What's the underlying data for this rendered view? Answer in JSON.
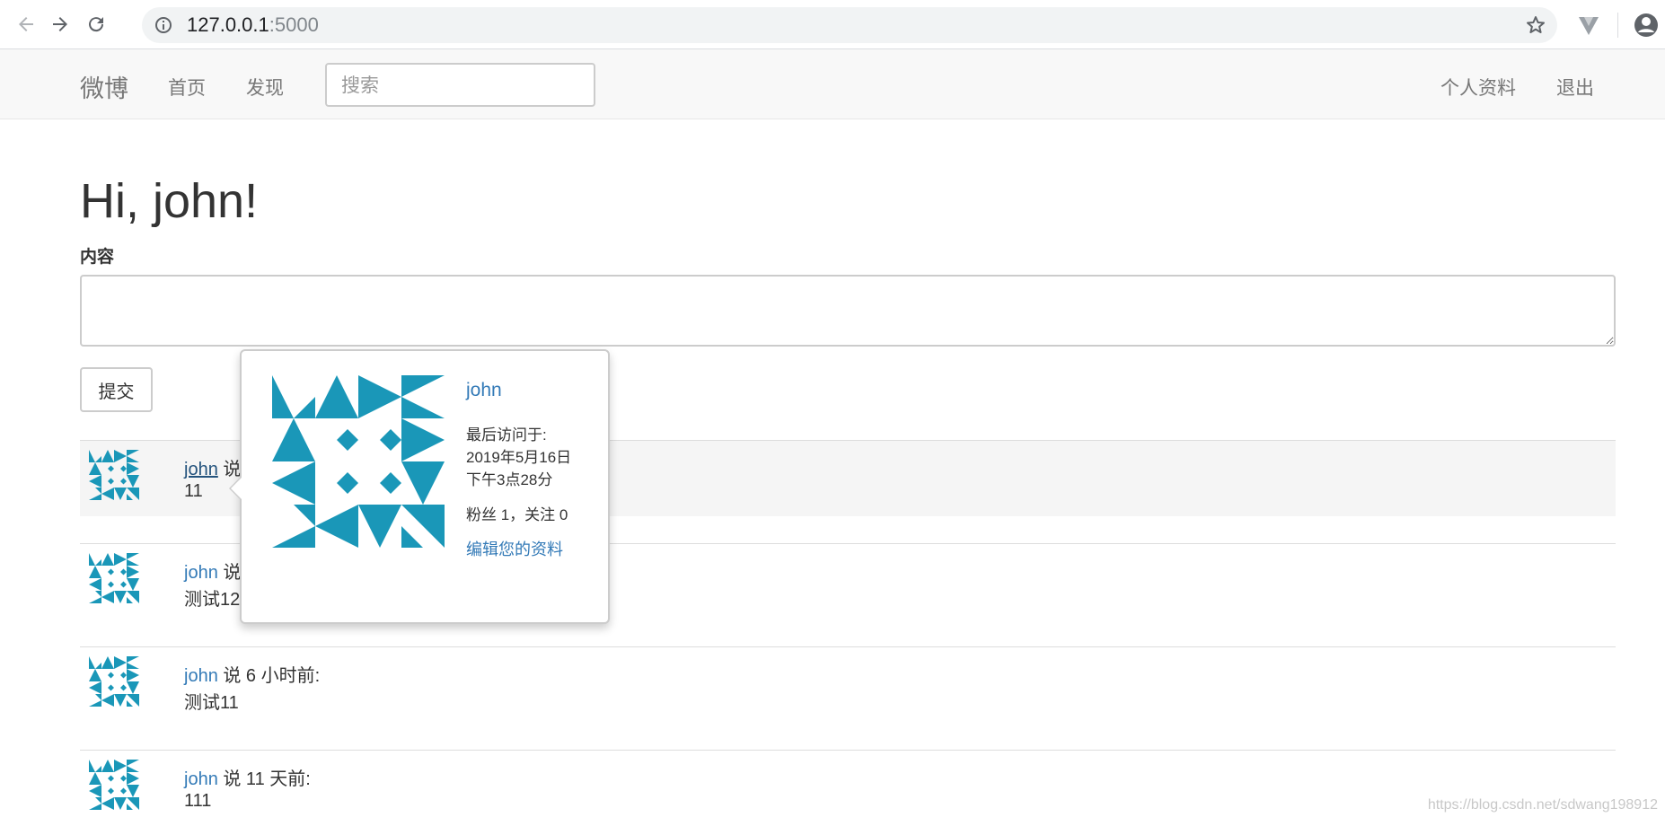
{
  "browser": {
    "url_host": "127.0.0.1",
    "url_port": ":5000",
    "icons": [
      "back-icon",
      "forward-icon",
      "reload-icon",
      "info-icon",
      "star-icon",
      "extension-icon",
      "profile-icon"
    ]
  },
  "navbar": {
    "brand": "微博",
    "links": [
      "首页",
      "发现"
    ],
    "search_placeholder": "搜索",
    "right_links": [
      "个人资料",
      "退出"
    ]
  },
  "main": {
    "greeting": "Hi, john!",
    "content_label": "内容",
    "submit_label": "提交"
  },
  "posts": [
    {
      "user": "john",
      "says": " 说",
      "body": "11"
    },
    {
      "user": "john",
      "says": " 说",
      "body": "测试12"
    },
    {
      "user": "john",
      "says": " 说 6 小时前:",
      "body": "测试11"
    },
    {
      "user": "john",
      "says": " 说 11 天前:",
      "body": "111"
    }
  ],
  "popover": {
    "username": "john",
    "last_seen_label": "最后访问于:",
    "last_seen_date": "2019年5月16日",
    "last_seen_time": "下午3点28分",
    "followers": "粉丝 1，关注 0",
    "edit_link": "编辑您的资料"
  },
  "colors": {
    "avatar": "#1a97b8",
    "link": "#337ab7",
    "navbar_bg": "#f8f8f8"
  },
  "watermark": "https://blog.csdn.net/sdwang198912"
}
